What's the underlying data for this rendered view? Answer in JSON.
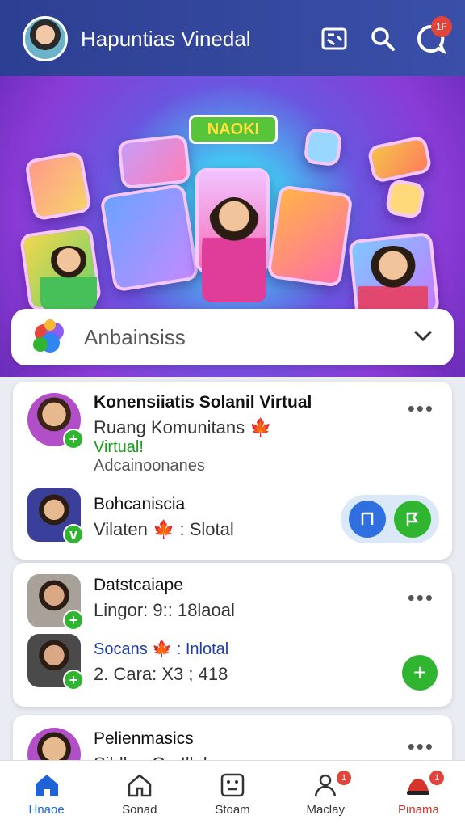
{
  "header": {
    "title": "Hapuntias Vinedal",
    "notification_badge": "1F",
    "icons": [
      "news-icon",
      "search-icon",
      "chat-icon"
    ]
  },
  "banner": {
    "badge_text": "NAOKI"
  },
  "selector": {
    "label": "Anbainsiss"
  },
  "feed": {
    "card1": {
      "item1": {
        "title": "Konensiiatis Solanil Virtual",
        "line1": "Ruang Komunitans 🍁",
        "line2": "Virtual!",
        "line3": "Adcainoonanes"
      },
      "item2": {
        "title": "Bohcaniscia",
        "line1": "Vilaten 🍁 : Slotal"
      }
    },
    "card2": {
      "item1": {
        "title": "Datstcaiape",
        "line1": "Lingor: 9:: 18laoal"
      },
      "item2": {
        "title": "Socans 🍁 : Inlotal",
        "line1": "2. Cara: X3 ; 418"
      }
    },
    "card3": {
      "item1": {
        "title": "Pelienmasics",
        "line1": "Sildlen On Illeks"
      }
    }
  },
  "bottom_nav": [
    {
      "label": "Hnaoe",
      "icon": "home-icon",
      "active": true,
      "color": "#1f63d6"
    },
    {
      "label": "Sonad",
      "icon": "house-outline-icon",
      "active": false,
      "color": "#333333"
    },
    {
      "label": "Stoam",
      "icon": "grid-icon",
      "active": false,
      "color": "#333333"
    },
    {
      "label": "Maclay",
      "icon": "person-alert-icon",
      "active": false,
      "color": "#333333",
      "badge": "1"
    },
    {
      "label": "Pinama",
      "icon": "hat-icon",
      "active": false,
      "color": "#d6332b",
      "badge": "1"
    }
  ],
  "colors": {
    "header": "#2c3f92",
    "accent_green": "#2fb52f",
    "accent_blue": "#1f63d6",
    "badge_red": "#e2443b"
  }
}
